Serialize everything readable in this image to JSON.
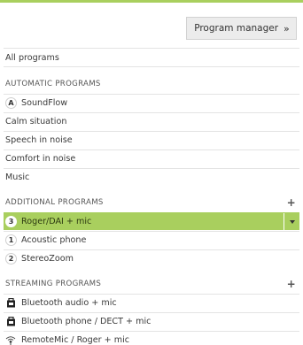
{
  "program_manager": {
    "label": "Program manager",
    "chevron": "»"
  },
  "all_programs": "All programs",
  "automatic": {
    "header": "AUTOMATIC PROGRAMS",
    "items": [
      {
        "label": "SoundFlow",
        "badge": "A"
      },
      {
        "label": "Calm situation"
      },
      {
        "label": "Speech in noise"
      },
      {
        "label": "Comfort in noise"
      },
      {
        "label": "Music"
      }
    ]
  },
  "additional": {
    "header": "ADDITIONAL PROGRAMS",
    "plus": "+",
    "items": [
      {
        "label": "Roger/DAI + mic",
        "badge": "3",
        "selected": true
      },
      {
        "label": "Acoustic phone",
        "badge": "1"
      },
      {
        "label": "StereoZoom",
        "badge": "2"
      }
    ]
  },
  "streaming": {
    "header": "STREAMING PROGRAMS",
    "plus": "+",
    "items": [
      {
        "label": "Bluetooth audio + mic",
        "icon": "bluetooth-device-icon"
      },
      {
        "label": "Bluetooth phone / DECT + mic",
        "icon": "bluetooth-device-icon"
      },
      {
        "label": "RemoteMic / Roger + mic",
        "icon": "wireless-mic-icon"
      }
    ]
  },
  "colors": {
    "accent": "#a9cf5e",
    "button_bg": "#ececec"
  }
}
